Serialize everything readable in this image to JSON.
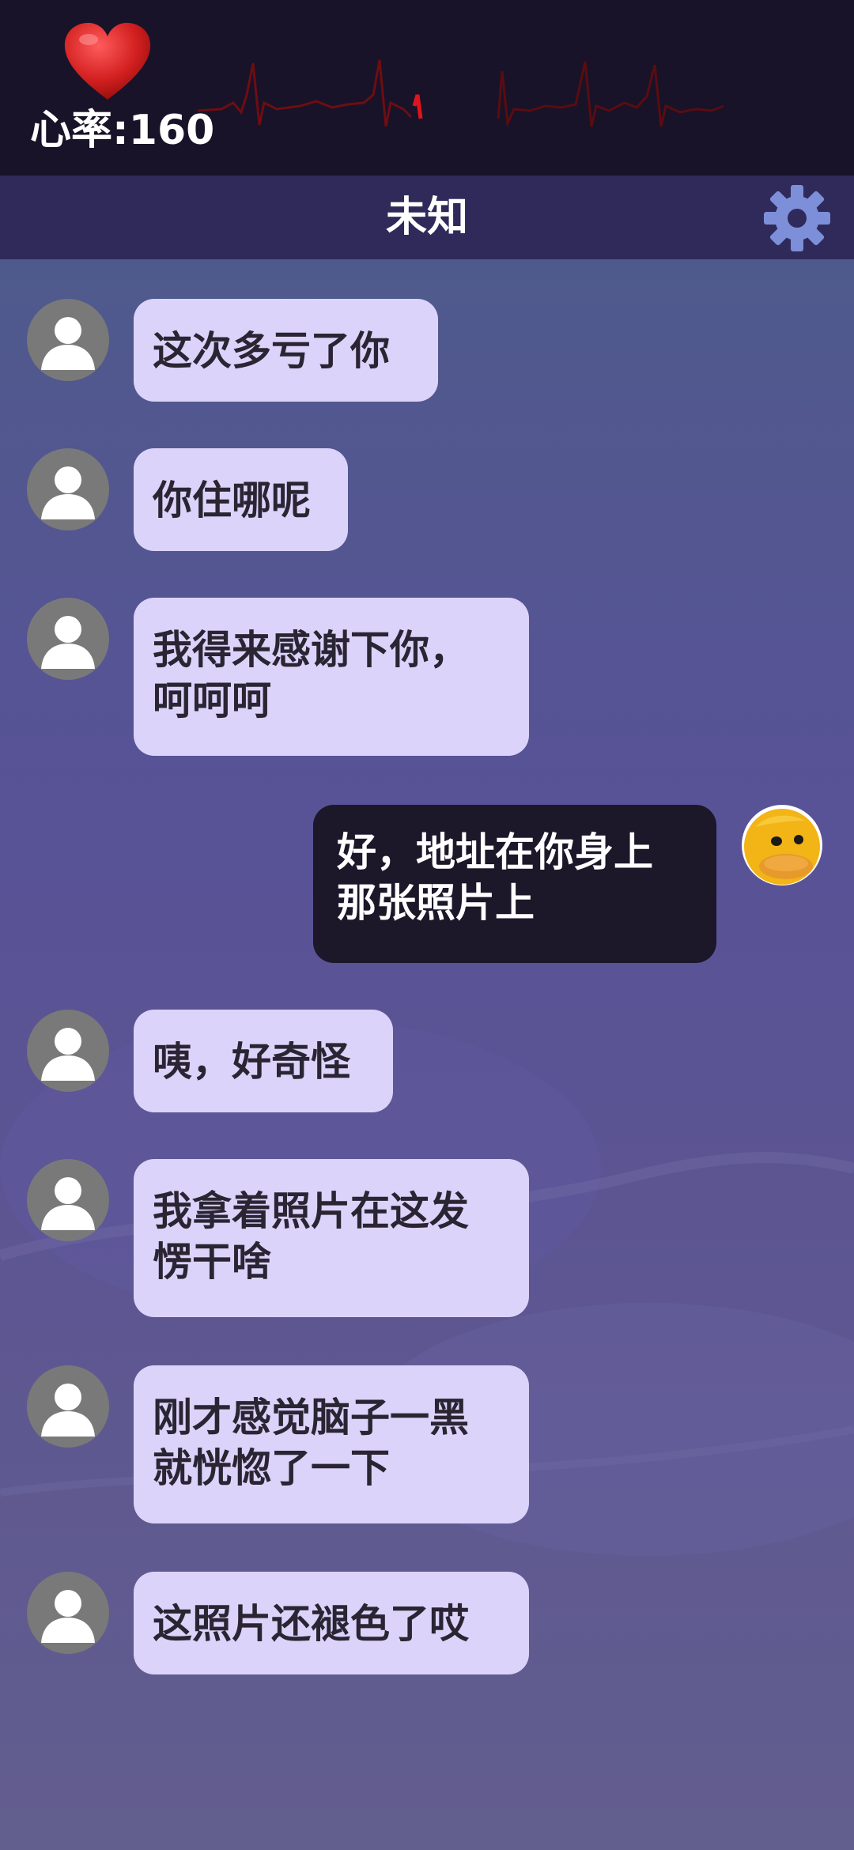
{
  "status": {
    "heart_rate_label": "心率:160",
    "heart_icon": "heart-icon",
    "ecg_color": "#c0141c"
  },
  "header": {
    "title": "未知",
    "settings_icon": "gear-icon"
  },
  "messages": [
    {
      "sender": "other",
      "text": "这次多亏了你"
    },
    {
      "sender": "other",
      "text": "你住哪呢"
    },
    {
      "sender": "other",
      "text": "我得来感谢下你，\n呵呵呵"
    },
    {
      "sender": "self",
      "text": "好，地址在你身上\n那张照片上"
    },
    {
      "sender": "other",
      "text": "咦，好奇怪"
    },
    {
      "sender": "other",
      "text": "我拿着照片在这发\n愣干啥"
    },
    {
      "sender": "other",
      "text": "刚才感觉脑子一黑\n就恍惚了一下"
    },
    {
      "sender": "other",
      "text": "这照片还褪色了哎"
    }
  ],
  "colors": {
    "bubble_other": "#dcd3fa",
    "bubble_self": "#1c1729",
    "top_bar": "#181328",
    "title_bar": "#2f2a5a"
  }
}
